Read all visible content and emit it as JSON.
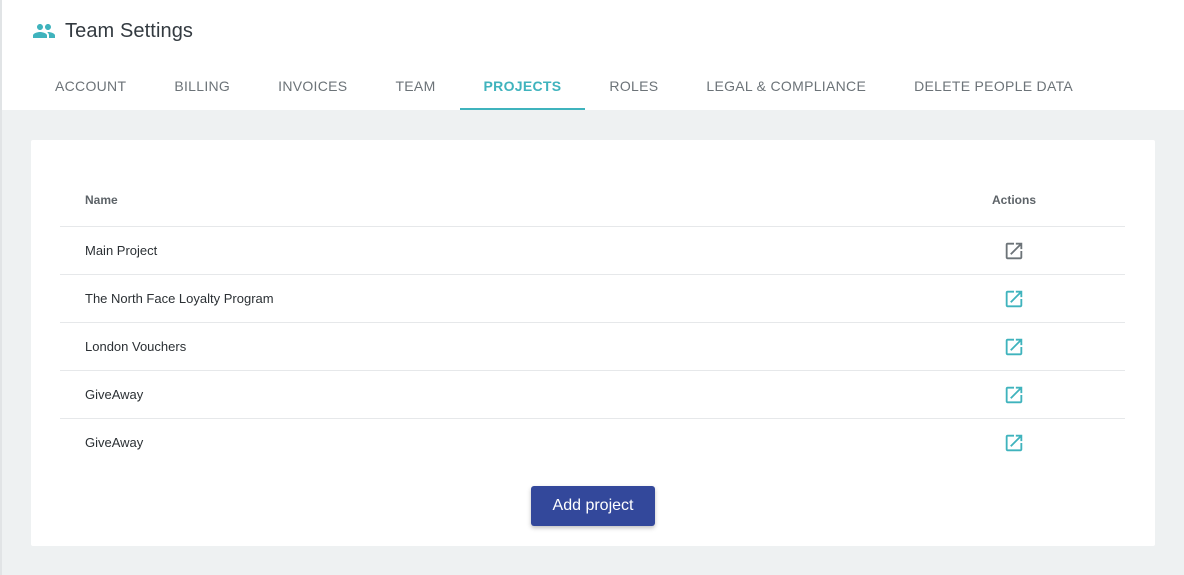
{
  "header": {
    "title": "Team Settings",
    "icon": "people-icon",
    "icon_color": "#3fb3bd"
  },
  "tabs": [
    {
      "label": "ACCOUNT",
      "active": false
    },
    {
      "label": "BILLING",
      "active": false
    },
    {
      "label": "INVOICES",
      "active": false
    },
    {
      "label": "TEAM",
      "active": false
    },
    {
      "label": "PROJECTS",
      "active": true
    },
    {
      "label": "ROLES",
      "active": false
    },
    {
      "label": "LEGAL & COMPLIANCE",
      "active": false
    },
    {
      "label": "DELETE PEOPLE DATA",
      "active": false
    }
  ],
  "table": {
    "columns": {
      "name": "Name",
      "actions": "Actions"
    },
    "rows": [
      {
        "name": "Main Project",
        "action_icon": "open-external-icon",
        "icon_color": "#6c7378"
      },
      {
        "name": "The North Face Loyalty Program",
        "action_icon": "open-external-icon",
        "icon_color": "#3fb3bd"
      },
      {
        "name": "London Vouchers",
        "action_icon": "open-external-icon",
        "icon_color": "#3fb3bd"
      },
      {
        "name": "GiveAway",
        "action_icon": "open-external-icon",
        "icon_color": "#3fb3bd"
      },
      {
        "name": "GiveAway",
        "action_icon": "open-external-icon",
        "icon_color": "#3fb3bd"
      }
    ]
  },
  "add_button": {
    "label": "Add project",
    "color": "#33489b"
  },
  "colors": {
    "accent": "#3fb3bd",
    "background": "#eef1f2"
  }
}
